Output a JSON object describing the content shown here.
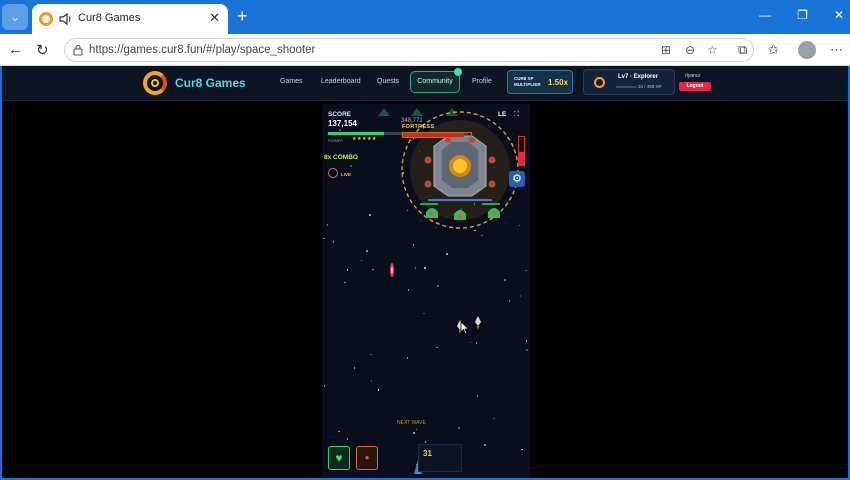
{
  "browser": {
    "tab_title": "Cur8 Games",
    "tab_close": "✕",
    "new_tab": "+",
    "url": "https://games.cur8.fun/#/play/space_shooter",
    "window_controls": [
      "—",
      "❐",
      "✕"
    ]
  },
  "site": {
    "name": "Cur8 Games",
    "nav": [
      "Games",
      "Leaderboard",
      "Quests",
      "Community",
      "Profile"
    ],
    "multiplier_label": "CUR8 XP MULTIPLIER",
    "multiplier_value": "1.50x",
    "level": "Lv7 · Explorer",
    "xp": "34 / 458 XP",
    "username": "rlyanur",
    "logout": "Logout"
  },
  "game": {
    "score_label": "SCORE",
    "score_value": "137,154",
    "level_tag": "LE",
    "boss_hp": "348,771",
    "boss_name": "FORTRESS",
    "combo": "8x COMBO",
    "live": "LIVE",
    "bottom_text": "NEXT WAVE",
    "ammo": "31",
    "stars": "★★★★★",
    "stat_label": "POWER",
    "boss_health_fraction": 0.9,
    "power_fraction": 0.4,
    "side_bar_fraction": 0.45
  },
  "colors": {
    "brand_accent": "#4fd8e6",
    "logout": "#e0284a",
    "multiplier_value": "#f7d44e"
  },
  "icons": {
    "heart_button": "heart-icon",
    "bomb_button": "bomb-icon",
    "settings": "gear-icon"
  }
}
